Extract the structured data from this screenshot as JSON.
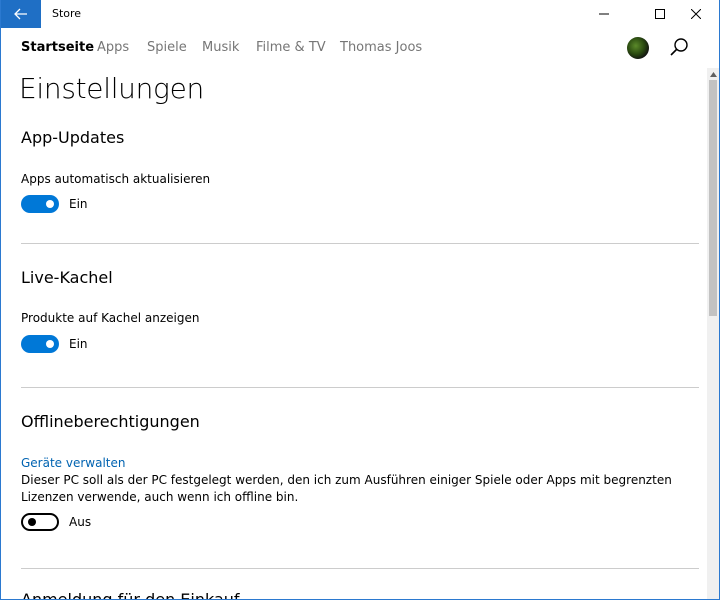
{
  "window": {
    "title": "Store",
    "accent": "#1f6fc5"
  },
  "nav": {
    "tabs": [
      {
        "label": "Startseite",
        "active": true
      },
      {
        "label": "Apps",
        "active": false
      },
      {
        "label": "Spiele",
        "active": false
      },
      {
        "label": "Musik",
        "active": false
      },
      {
        "label": "Filme & TV",
        "active": false
      },
      {
        "label": "Thomas Joos",
        "active": false
      }
    ]
  },
  "page": {
    "title": "Einstellungen"
  },
  "sections": {
    "app_updates": {
      "title": "App-Updates",
      "setting_label": "Apps automatisch aktualisieren",
      "toggle_on": true,
      "state_label": "Ein"
    },
    "live_tile": {
      "title": "Live-Kachel",
      "setting_label": "Produkte auf Kachel anzeigen",
      "toggle_on": true,
      "state_label": "Ein"
    },
    "offline": {
      "title": "Offlineberechtigungen",
      "link": "Geräte verwalten",
      "description": "Dieser PC soll als der PC festgelegt werden, den ich zum Ausführen einiger Spiele oder Apps mit begrenzten Lizenzen verwende, auch wenn ich offline bin.",
      "toggle_on": false,
      "state_label": "Aus"
    },
    "purchase": {
      "title": "Anmeldung für den Einkauf"
    }
  },
  "colors": {
    "toggle_on": "#0078d7",
    "link": "#0063b1",
    "divider": "#cccccc"
  }
}
